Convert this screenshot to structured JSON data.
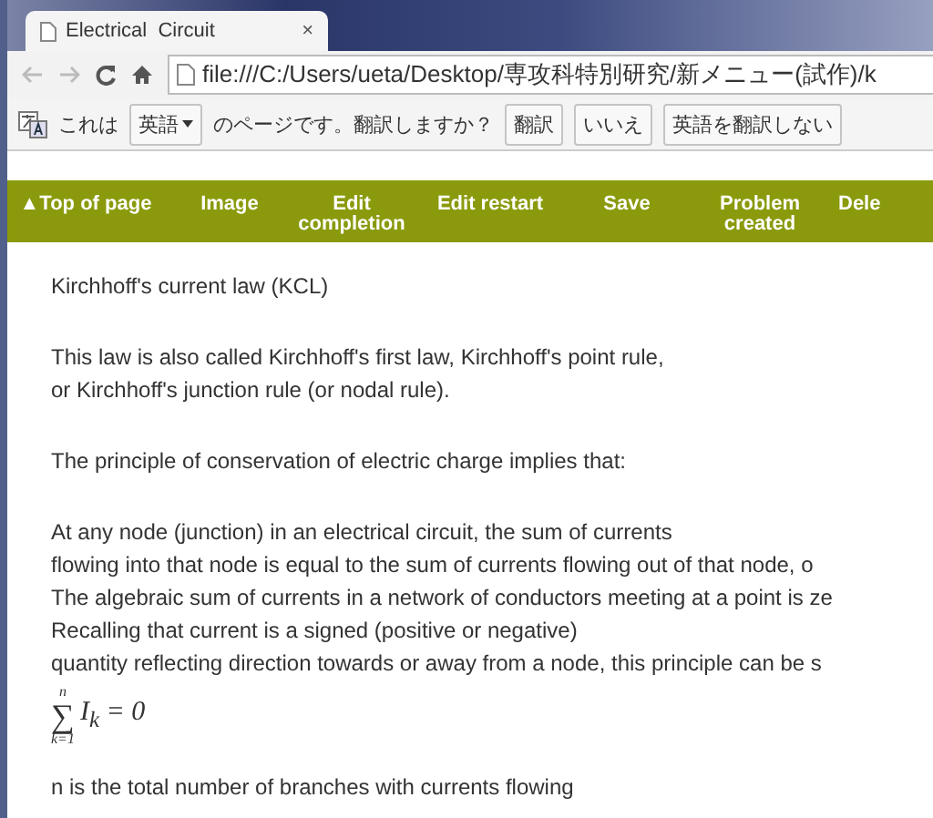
{
  "tab": {
    "title": "Electrical  Circuit",
    "close": "×"
  },
  "address_bar": {
    "url": "file:///C:/Users/ueta/Desktop/専攻科特別研究/新メニュー(試作)/k"
  },
  "translate_bar": {
    "prefix": "これは",
    "language": "英語",
    "suffix": "のページです。翻訳しますか？",
    "buttons": [
      "翻訳",
      "いいえ",
      "英語を翻訳しない"
    ]
  },
  "nav": [
    {
      "label": "▲Top of page"
    },
    {
      "label": "Image"
    },
    {
      "label": "Edit completion"
    },
    {
      "label": "Edit restart"
    },
    {
      "label": "Save"
    },
    {
      "label": "Problem created"
    },
    {
      "label": "Dele"
    }
  ],
  "content": {
    "paragraphs": [
      [
        "Kirchhoff's current law (KCL)"
      ],
      [
        "This law is also called Kirchhoff's first law, Kirchhoff's point rule,",
        "or Kirchhoff's junction rule (or nodal rule)."
      ],
      [
        "The principle of conservation of electric charge implies that:"
      ],
      [
        "At any node (junction) in an electrical circuit, the sum of currents",
        "flowing into that node is equal to the sum of currents flowing out of that node, o",
        "The algebraic sum of currents in a network of conductors meeting at a point is ze",
        "Recalling that current is a signed (positive or negative)",
        "quantity reflecting direction towards or away from a node, this principle can be s"
      ]
    ],
    "formula": {
      "upper": "n",
      "symbol": "∑",
      "lower": "k=1",
      "body": "I$_{k}$ = 0"
    },
    "after": "n is the total number of branches with currents flowing"
  }
}
